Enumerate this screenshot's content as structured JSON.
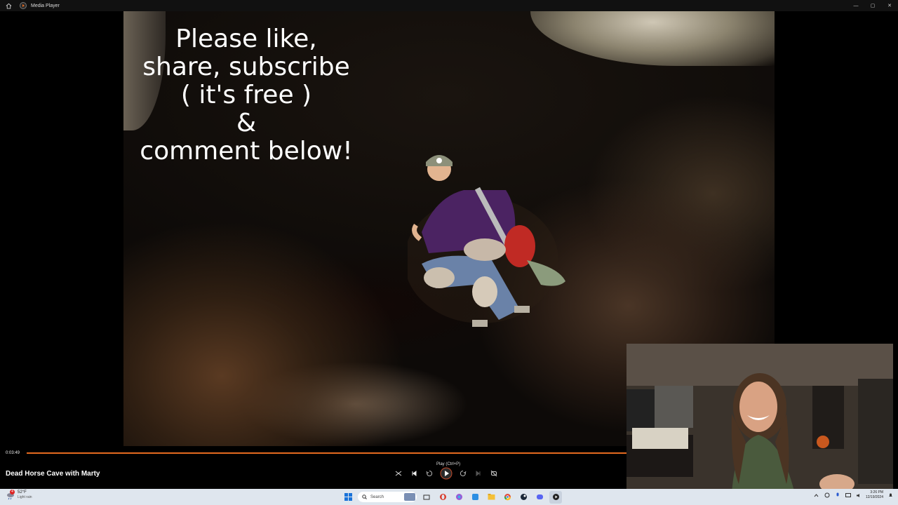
{
  "window": {
    "title": "Media Player",
    "controls": {
      "minimize": "—",
      "maximize": "▢",
      "close": "✕"
    }
  },
  "video": {
    "overlay_text": [
      "Please like,",
      "share, subscribe",
      "( it's free )",
      "&",
      "comment below!"
    ],
    "title": "Dead Horse Cave with Marty",
    "current_time": "0:03:49",
    "progress_fraction": 1.0
  },
  "controls": {
    "tooltip": "Play (Ctrl+P)",
    "icons": [
      "shuffle-icon",
      "previous-icon",
      "rewind-10-icon",
      "play-icon",
      "forward-30-icon",
      "next-icon",
      "repeat-off-icon"
    ]
  },
  "taskbar": {
    "weather": {
      "temp": "52°F",
      "condition": "Light rain",
      "alert_count": "4"
    },
    "search_placeholder": "Search",
    "clock": {
      "time": "3:26 PM",
      "date": "12/19/2024"
    }
  },
  "colors": {
    "accent": "#e46a1f",
    "taskbar": "#dfe6ee"
  }
}
